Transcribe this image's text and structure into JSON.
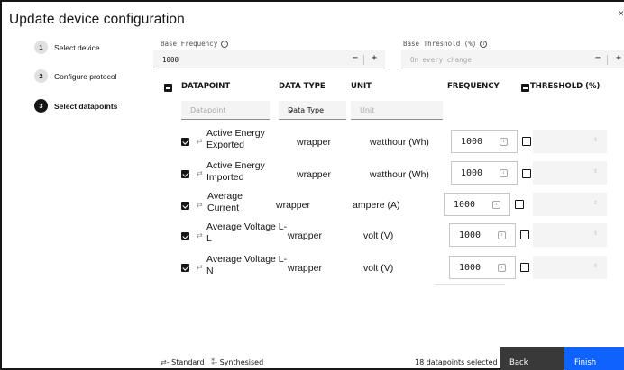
{
  "modal": {
    "title": "Update device configuration",
    "close_glyph": "×"
  },
  "steps": [
    {
      "num": "1",
      "label": "Select device",
      "state": "complete"
    },
    {
      "num": "2",
      "label": "Configure protocol",
      "state": "complete"
    },
    {
      "num": "3",
      "label": "Select datapoints",
      "state": "current"
    }
  ],
  "base_frequency": {
    "label": "Base Frequency",
    "value": "1000",
    "info_glyph": "i",
    "minus": "−",
    "plus": "+"
  },
  "base_threshold": {
    "label": "Base Threshold (%)",
    "placeholder": "On every change",
    "info_glyph": "i",
    "minus": "−",
    "plus": "+"
  },
  "table": {
    "headers": {
      "datapoint": "DATAPOINT",
      "data_type": "DATA TYPE",
      "unit": "UNIT",
      "frequency": "FREQUENCY",
      "threshold": "THRESHOLD (%)"
    },
    "filters": {
      "datapoint_placeholder": "Datapoint",
      "data_type_value": "Data Type",
      "unit_placeholder": "Unit"
    },
    "rows": [
      {
        "name": "Active Energy Exported",
        "data_type": "wrapper",
        "unit": "watthour (Wh)",
        "frequency": "1000",
        "checked": true,
        "icon": "standard-icon"
      },
      {
        "name": "Active Energy Imported",
        "data_type": "wrapper",
        "unit": "watthour (Wh)",
        "frequency": "1000",
        "checked": true,
        "icon": "standard-icon"
      },
      {
        "name": "Average Current",
        "data_type": "wrapper",
        "unit": "ampere (A)",
        "frequency": "1000",
        "checked": true,
        "icon": "standard-icon"
      },
      {
        "name": "Average Voltage L-L",
        "data_type": "wrapper",
        "unit": "volt (V)",
        "frequency": "1000",
        "checked": true,
        "icon": "standard-icon"
      },
      {
        "name": "Average Voltage L-N",
        "data_type": "wrapper",
        "unit": "volt (V)",
        "frequency": "1000",
        "checked": true,
        "icon": "standard-icon"
      }
    ]
  },
  "footer": {
    "legend_standard": "- Standard",
    "legend_synthesised": "- Synthesised",
    "selected_count": "18 datapoints selected",
    "back_label": "Back",
    "finish_label": "Finish"
  },
  "colors": {
    "primary": "#0f62fe",
    "secondary": "#393939",
    "field_bg": "#f4f4f4",
    "text": "#161616"
  }
}
